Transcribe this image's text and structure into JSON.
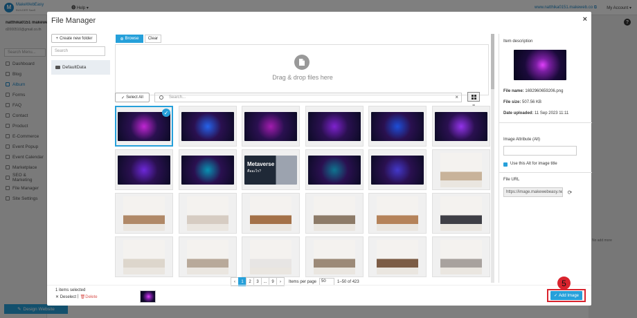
{
  "app": {
    "logo_letter": "M",
    "logo_name": "MakeWebEasy",
    "logo_sub": "BUILDER SaaS",
    "help_label": "Help",
    "site_link": "www.natthika0151.makeweb.co",
    "account_label": "My Account",
    "user_name": "natthika0151 makeweb",
    "user_email": "d2000510@gmail.co.th",
    "search_menu_placeholder": "Search Menu...",
    "menu": [
      {
        "label": "Dashboard",
        "icon": "dashboard-icon"
      },
      {
        "label": "Blog",
        "icon": "blog-icon"
      },
      {
        "label": "Album",
        "icon": "album-icon",
        "active": true
      },
      {
        "label": "Forms",
        "icon": "forms-icon"
      },
      {
        "label": "FAQ",
        "icon": "faq-icon"
      },
      {
        "label": "Contact",
        "icon": "contact-icon"
      },
      {
        "label": "Product",
        "icon": "product-icon"
      },
      {
        "label": "E-Commerce",
        "icon": "ecommerce-icon"
      },
      {
        "label": "Event Popup",
        "icon": "event-popup-icon"
      },
      {
        "label": "Event Calendar",
        "icon": "calendar-icon"
      },
      {
        "label": "Marketplace",
        "icon": "marketplace-icon"
      },
      {
        "label": "SEO & Marketing",
        "icon": "seo-icon"
      },
      {
        "label": "File Manager",
        "icon": "file-manager-icon"
      },
      {
        "label": "Site Settings",
        "icon": "settings-icon"
      }
    ],
    "design_button": "Design Website",
    "bg_note": "No add more"
  },
  "modal": {
    "title": "File Manager",
    "close": "×",
    "new_folder": "Create new folder",
    "folder_search_placeholder": "Search",
    "folder": "DefaultData",
    "tabs": {
      "browse": "Browse",
      "clear": "Clear"
    },
    "drop_text": "Drag & drop files here",
    "select_all": "Select All",
    "search_placeholder": "Search...",
    "search_clear": "×",
    "pagination": {
      "pages": [
        "‹",
        "1",
        "2",
        "3",
        "...",
        "9",
        "›"
      ],
      "current": "1",
      "per_page_label": "Items per page",
      "per_page_value": "50",
      "range": "1–50 of 423"
    },
    "details": {
      "item_description": "Item description",
      "file_name_label": "File name:",
      "file_name": "1692960659206.png",
      "file_size_label": "File size:",
      "file_size": "507.56 KB",
      "date_label": "Date uploaded:",
      "date": "11 Sep 2023 11:11",
      "image_attr_label": "Image Attribute (Alt)",
      "use_alt_label": "Use this Alt for image title",
      "file_url_label": "File URL",
      "file_url": "https://image.makewebeasy.ne"
    },
    "footer": {
      "selected_count": "1 items selected",
      "deselect": "Deselect",
      "separator": "|",
      "delete": "Delete",
      "add_image": "Add Image"
    },
    "annotation": "5",
    "thumbnails": [
      {
        "kind": "tech",
        "color": "#c026d3",
        "selected": true
      },
      {
        "kind": "tech",
        "color": "#2563eb"
      },
      {
        "kind": "tech",
        "color": "#a21caf"
      },
      {
        "kind": "tech",
        "color": "#7e22ce"
      },
      {
        "kind": "tech",
        "color": "#1d4ed8"
      },
      {
        "kind": "tech",
        "color": "#9333ea"
      },
      {
        "kind": "tech",
        "color": "#6d28d9"
      },
      {
        "kind": "tech",
        "color": "#0891b2"
      },
      {
        "kind": "metaverse",
        "color": "#1f2937",
        "heading": "Metaverse",
        "sub": "คืออะไร?"
      },
      {
        "kind": "tech",
        "color": "#0e7490"
      },
      {
        "kind": "tech",
        "color": "#4338ca"
      },
      {
        "kind": "room",
        "color": "#c8b39a"
      },
      {
        "kind": "room",
        "color": "#b08968"
      },
      {
        "kind": "room",
        "color": "#d6ccc2"
      },
      {
        "kind": "room",
        "color": "#a47148"
      },
      {
        "kind": "room",
        "color": "#8d7b68"
      },
      {
        "kind": "room",
        "color": "#b5835a"
      },
      {
        "kind": "room",
        "color": "#3f3f46"
      },
      {
        "kind": "room",
        "color": "#ddd6cc"
      },
      {
        "kind": "room",
        "color": "#b8a99a"
      },
      {
        "kind": "room",
        "color": "#e7e5e4"
      },
      {
        "kind": "room",
        "color": "#9c8a78"
      },
      {
        "kind": "room",
        "color": "#7c5c45"
      },
      {
        "kind": "room",
        "color": "#a8a29e"
      }
    ]
  }
}
